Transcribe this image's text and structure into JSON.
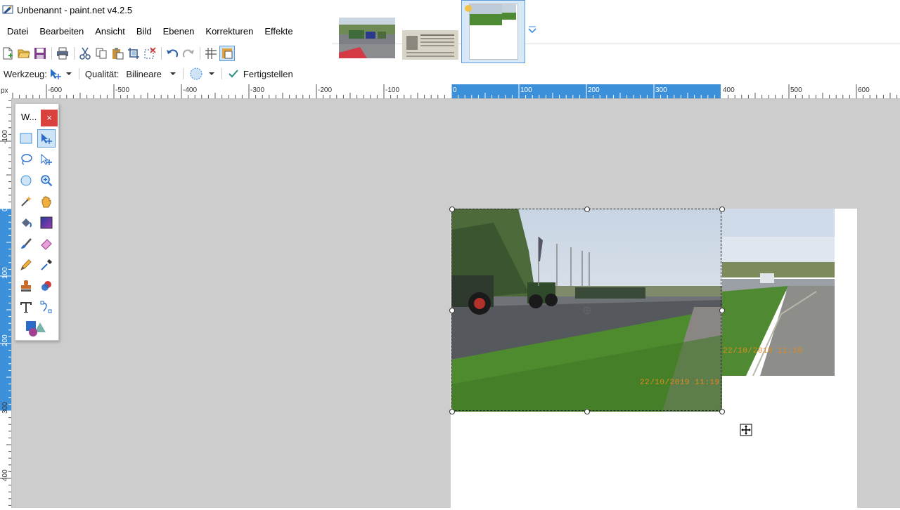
{
  "window": {
    "title": "Unbenannt - paint.net v4.2.5"
  },
  "menu": {
    "items": [
      "Datei",
      "Bearbeiten",
      "Ansicht",
      "Bild",
      "Ebenen",
      "Korrekturen",
      "Effekte"
    ]
  },
  "image_tabs": [
    {
      "name": "tractors-photo",
      "selected": false
    },
    {
      "name": "newspaper-scan",
      "selected": false
    },
    {
      "name": "composite-unbenannt",
      "selected": true
    }
  ],
  "toolbar": {
    "icons": [
      "new-file-icon",
      "open-file-icon",
      "save-icon",
      "print-icon",
      "cut-icon",
      "copy-icon",
      "paste-icon",
      "crop-icon",
      "deselect-icon",
      "undo-icon",
      "redo-icon",
      "grid-icon",
      "ruler-icon"
    ]
  },
  "options": {
    "tool_label": "Werkzeug:",
    "quality_label": "Qualität:",
    "quality_value": "Bilineare",
    "finish_label": "Fertigstellen"
  },
  "ruler": {
    "unit": "px",
    "h_labels": [
      "-600",
      "-500",
      "-400",
      "-300",
      "-200",
      "-100",
      "0",
      "100",
      "200",
      "300",
      "400",
      "500",
      "600"
    ],
    "v_labels": [
      "-100",
      "0",
      "100",
      "200",
      "300",
      "400"
    ]
  },
  "tools_window": {
    "title": "W...",
    "close": "×",
    "tools": [
      "rectangle-select",
      "move-selected-pixels",
      "lasso-select",
      "move-selection",
      "ellipse-select",
      "zoom",
      "magic-wand",
      "pan",
      "paint-bucket",
      "gradient",
      "paintbrush",
      "eraser",
      "pencil",
      "color-picker",
      "clone-stamp",
      "recolor",
      "text",
      "line-curve",
      "shapes"
    ]
  },
  "canvas": {
    "date_stamp_front": "22/10/2019 11:19",
    "date_stamp_back": "22/10/2019 11:10"
  },
  "colors": {
    "accent": "#3c8fd9",
    "workspace": "#cdcdcd",
    "close": "#d9413c"
  }
}
